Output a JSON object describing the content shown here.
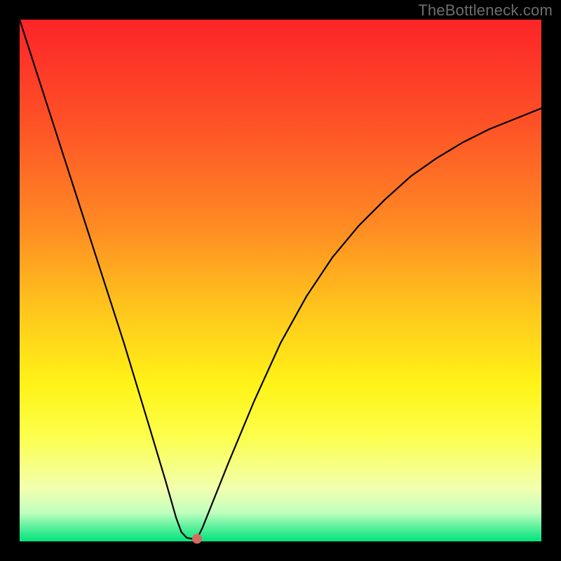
{
  "watermark": "TheBottleneck.com",
  "chart_data": {
    "type": "line",
    "title": "",
    "xlabel": "",
    "ylabel": "",
    "xlim": [
      0,
      100
    ],
    "ylim": [
      0,
      100
    ],
    "grid": false,
    "legend": false,
    "series": [
      {
        "name": "curve",
        "x": [
          0,
          5,
          10,
          15,
          20,
          25,
          28,
          30,
          31,
          32,
          33,
          34,
          35,
          40,
          45,
          50,
          55,
          60,
          65,
          70,
          75,
          80,
          85,
          90,
          95,
          100
        ],
        "y": [
          100,
          84.5,
          69,
          53.5,
          38,
          21.5,
          11.5,
          4.5,
          1.8,
          0.7,
          0.5,
          0.5,
          2.5,
          15,
          27,
          38,
          47,
          54.5,
          60.5,
          65.5,
          70,
          73.5,
          76.5,
          79,
          81,
          83
        ]
      }
    ],
    "flat_bottom": {
      "x_start": 31,
      "x_end": 34,
      "y": 0.5
    },
    "marker": {
      "x": 34,
      "y": 0.5,
      "color": "#d46a5f",
      "radius_px": 7
    },
    "background_gradient": {
      "type": "vertical",
      "stops": [
        {
          "pos": 0.0,
          "color": "#fd2428"
        },
        {
          "pos": 0.2,
          "color": "#fe5227"
        },
        {
          "pos": 0.4,
          "color": "#ff8c23"
        },
        {
          "pos": 0.55,
          "color": "#ffc41d"
        },
        {
          "pos": 0.7,
          "color": "#fff317"
        },
        {
          "pos": 0.8,
          "color": "#fcff4d"
        },
        {
          "pos": 0.9,
          "color": "#f2ffb0"
        },
        {
          "pos": 0.945,
          "color": "#c0ffbe"
        },
        {
          "pos": 0.97,
          "color": "#64f19f"
        },
        {
          "pos": 1.0,
          "color": "#00e47c"
        }
      ]
    },
    "frame_color": "#000000",
    "frame_thickness_px": 28,
    "curve_color": "#000000",
    "curve_thickness_px": 2.2
  }
}
